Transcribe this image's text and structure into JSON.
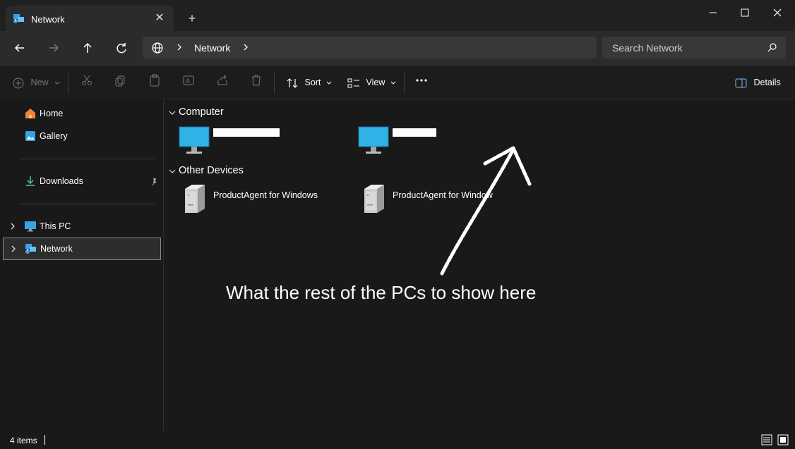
{
  "window": {
    "tab_title": "Network",
    "controls": {
      "minimize": "minimize-icon",
      "maximize": "maximize-icon",
      "close": "close-icon"
    }
  },
  "nav": {
    "address_segments": [
      "Network"
    ],
    "search_placeholder": "Search Network"
  },
  "toolbar": {
    "new_label": "New",
    "sort_label": "Sort",
    "view_label": "View",
    "details_label": "Details"
  },
  "sidebar": {
    "home": "Home",
    "gallery": "Gallery",
    "downloads": "Downloads",
    "this_pc": "This PC",
    "network": "Network"
  },
  "content": {
    "groups": [
      {
        "title": "Computer",
        "items": [
          "",
          ""
        ]
      },
      {
        "title": "Other Devices",
        "items": [
          "ProductAgent for Windows",
          "ProductAgent for Windows"
        ]
      }
    ],
    "annotation": "What the rest of the PCs to show here"
  },
  "status": {
    "item_count": "4 items"
  },
  "colors": {
    "background": "#191919",
    "toolbar": "#2b2b2b",
    "accent_blue": "#3aa0e8",
    "text": "#ffffff"
  }
}
